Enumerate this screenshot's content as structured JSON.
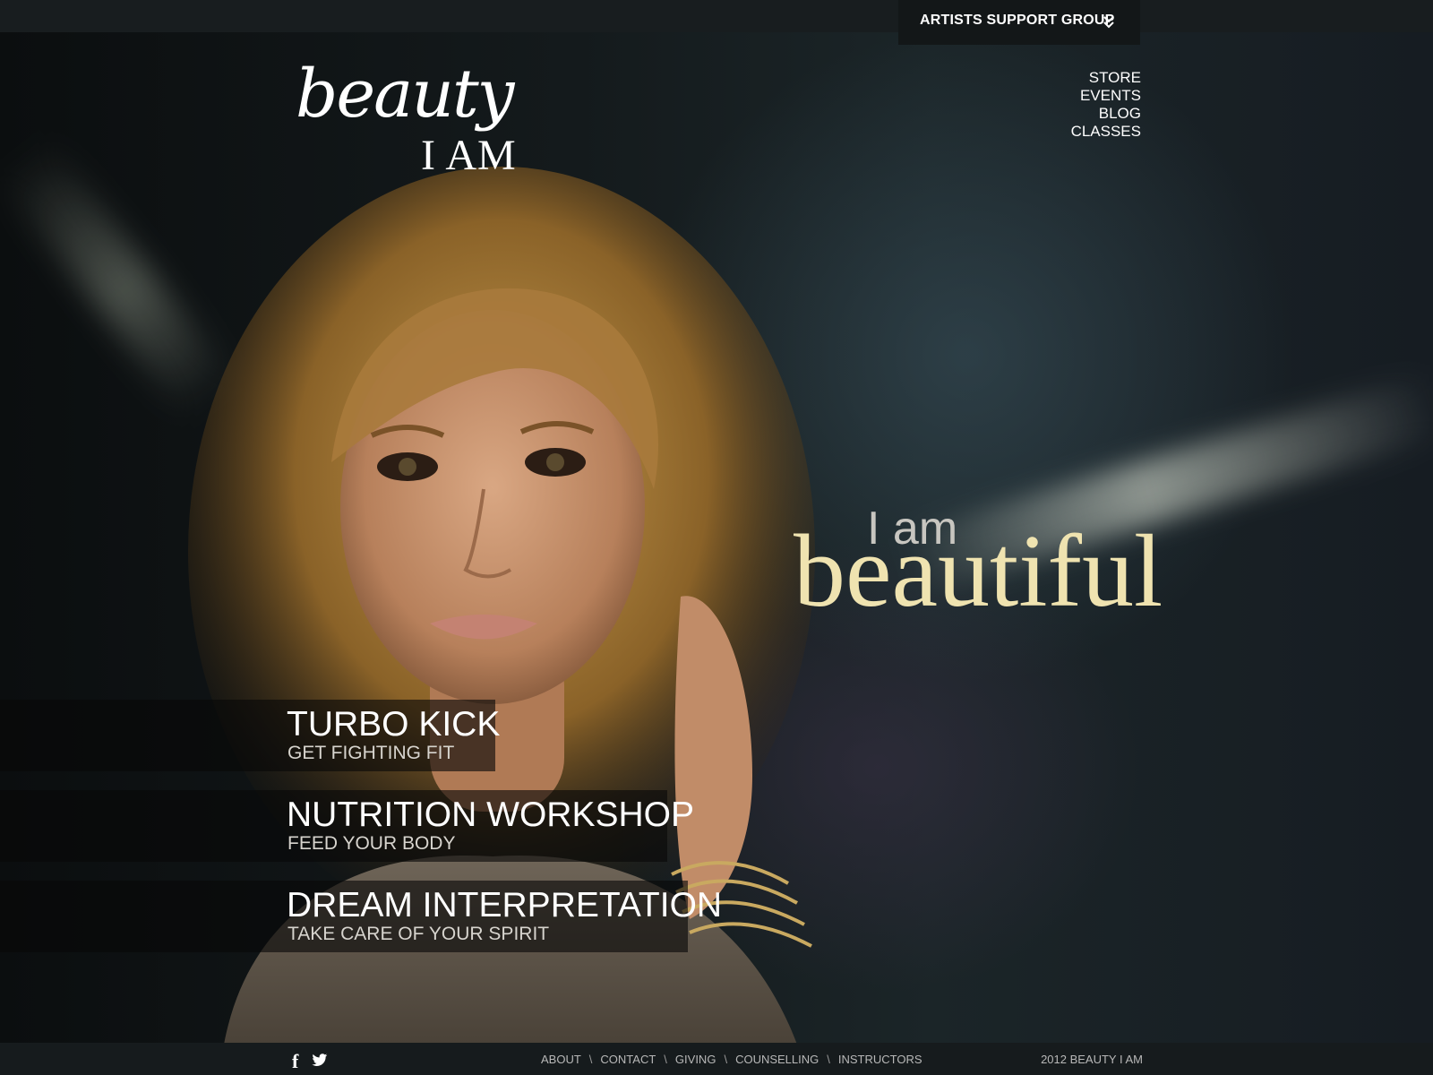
{
  "topbar": {
    "support_label": "ARTISTS SUPPORT GROUP"
  },
  "logo": {
    "script": "beauty",
    "sub": "I AM"
  },
  "nav": [
    "STORE",
    "EVENTS",
    "BLOG",
    "CLASSES"
  ],
  "tagline": {
    "small": "I am",
    "big": "beautiful"
  },
  "classes": [
    {
      "title": "TURBO KICK",
      "subtitle": "GET FIGHTING FIT"
    },
    {
      "title": "NUTRITION WORKSHOP",
      "subtitle": "FEED YOUR BODY"
    },
    {
      "title": "DREAM INTERPRETATION",
      "subtitle": "TAKE CARE OF YOUR SPIRIT"
    }
  ],
  "footer": {
    "links": [
      "ABOUT",
      "CONTACT",
      "GIVING",
      "COUNSELLING",
      "INSTRUCTORS"
    ],
    "copyright": "2012 BEAUTY I AM"
  },
  "colors": {
    "accent_gold": "#efe3b0",
    "bar": "#181d1f"
  },
  "icons": {
    "facebook": "facebook-icon",
    "twitter": "twitter-icon",
    "dropdown": "double-chevron-down-icon"
  }
}
